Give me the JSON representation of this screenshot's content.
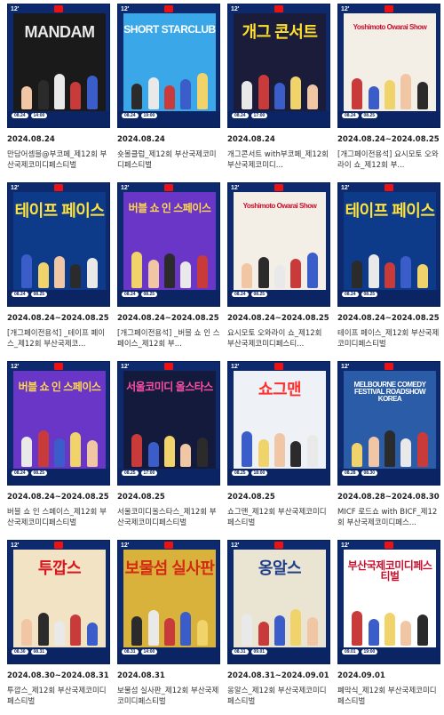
{
  "cards": [
    {
      "date": "2024.08.24",
      "title": "만담어셈블@부코페_제12회 부산국제코미디페스티벌",
      "art_title": "MANDAM",
      "art_bg": "#1a1a1a",
      "title_color": "#e8e8e8",
      "ed": "12'",
      "pill1": "08.24",
      "pill2": "14:00"
    },
    {
      "date": "2024.08.24",
      "title": "숏볼클럽_제12회 부산국제코미디페스티벌",
      "art_title": "SHORT STARCLUB",
      "art_bg": "#3aa8e8",
      "title_color": "#ffffff",
      "ed": "12'",
      "pill1": "08.24",
      "pill2": "19:00"
    },
    {
      "date": "2024.08.24",
      "title": "개그콘서트 with부코페_제12회 부산국제코미디...",
      "art_title": "개그 콘서트",
      "art_bg": "#1b1b3a",
      "title_color": "#ffe02e",
      "ed": "12'",
      "pill1": "08.24",
      "pill2": "17:00"
    },
    {
      "date": "2024.08.24~2024.08.25",
      "title": "[개그페이전용석] 요시모토 오와라이 쇼_제12회 부...",
      "art_title": "Yoshimoto Owarai Show",
      "art_bg": "#f4efe6",
      "title_color": "#c8102e",
      "ed": "12'",
      "pill1": "08.24",
      "pill2": "08.25"
    },
    {
      "date": "2024.08.24~2024.08.25",
      "title": "[개그페이전용석] _테이프 페이스_제12회 부산국제코...",
      "art_title": "테이프 페이스",
      "art_bg": "#0e3a8a",
      "title_color": "#ffe23a",
      "ed": "12'",
      "pill1": "08.24",
      "pill2": "08.25"
    },
    {
      "date": "2024.08.24~2024.08.25",
      "title": "[개그페이전용석] _버블 쇼 인 스페이스_제12회 부...",
      "art_title": "버블 쇼 인 스페이스",
      "art_bg": "#6a36c8",
      "title_color": "#ffd94a",
      "ed": "12'",
      "pill1": "08.24",
      "pill2": "08.25"
    },
    {
      "date": "2024.08.24~2024.08.25",
      "title": "요시모토 오와라이 쇼_제12회 부산국제코미디페스티...",
      "art_title": "Yoshimoto Owarai Show",
      "art_bg": "#f4efe6",
      "title_color": "#c8102e",
      "ed": "12'",
      "pill1": "08.24",
      "pill2": "08.25"
    },
    {
      "date": "2024.08.24~2024.08.25",
      "title": "테이프 페이스_제12회 부산국제코미디페스티벌",
      "art_title": "테이프 페이스",
      "art_bg": "#0e3a8a",
      "title_color": "#ffe23a",
      "ed": "12'",
      "pill1": "08.24",
      "pill2": "08.25"
    },
    {
      "date": "2024.08.24~2024.08.25",
      "title": "버블 쇼 인 스페이스_제12회 부산국제코미디페스티벌",
      "art_title": "버블 쇼 인 스페이스",
      "art_bg": "#6a36c8",
      "title_color": "#ffd94a",
      "ed": "12'",
      "pill1": "08.24",
      "pill2": "08.25"
    },
    {
      "date": "2024.08.25",
      "title": "서울코미디올스타스_제12회 부산국제코미디페스티벌",
      "art_title": "서울코미디 올스타스",
      "art_bg": "#141a3c",
      "title_color": "#ff4fa8",
      "ed": "12'",
      "pill1": "08.25",
      "pill2": "17:00"
    },
    {
      "date": "2024.08.25",
      "title": "쇼그맨_제12회 부산국제코미디페스티벌",
      "art_title": "쇼그맨",
      "art_bg": "#eef2f7",
      "title_color": "#ff2f2f",
      "ed": "12'",
      "pill1": "08.25",
      "pill2": "18:00"
    },
    {
      "date": "2024.08.28~2024.08.30",
      "title": "MICF 로드쇼 with BICF_제12회 부산국제코미디페스...",
      "art_title": "MELBOURNE COMEDY FESTIVAL ROADSHOW KOREA",
      "art_bg": "#2a5ca8",
      "title_color": "#ffffff",
      "ed": "12'",
      "pill1": "08.28",
      "pill2": "08.30"
    },
    {
      "date": "2024.08.30~2024.08.31",
      "title": "투깝스_제12회 부산국제코미디페스티벌",
      "art_title": "투깝스",
      "art_bg": "#f2e3c4",
      "title_color": "#d8141e",
      "ed": "12'",
      "pill1": "08.30",
      "pill2": "08.31"
    },
    {
      "date": "2024.08.31",
      "title": "보물섬 실사판_제12회 부산국제코미디페스티벌",
      "art_title": "보물섬 실사판",
      "art_bg": "#d8b23a",
      "title_color": "#d42a14",
      "ed": "12'",
      "pill1": "08.31",
      "pill2": "14:00"
    },
    {
      "date": "2024.08.31~2024.09.01",
      "title": "옹알스_제12회 부산국제코미디페스티벌",
      "art_title": "옹알스",
      "art_bg": "#eae4d2",
      "title_color": "#1f3f8c",
      "ed": "12'",
      "pill1": "08.31",
      "pill2": "09.01"
    },
    {
      "date": "2024.09.01",
      "title": "폐막식_제12회 부산국제코미디페스티벌",
      "art_title": "부산국제코미디페스티벌",
      "art_bg": "#ffffff",
      "title_color": "#c8102e",
      "ed": "12'",
      "pill1": "09.01",
      "pill2": "19:00"
    }
  ]
}
